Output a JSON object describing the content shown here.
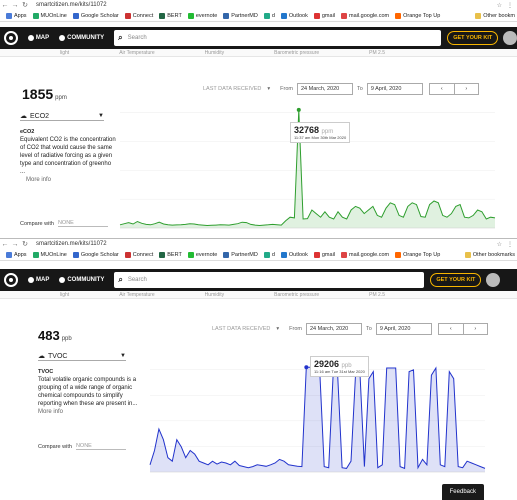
{
  "browser": {
    "url": "smartcitizen.me/kits/11072",
    "bookmarks": [
      "Apps",
      "MUOnLine",
      "Google Scholar",
      "Connect",
      "BERT",
      "evernote",
      "PartnerMD",
      "d",
      "Outlook",
      "gmail",
      "mail.google.com",
      "Orange Top Up"
    ],
    "other_bookmarks_a": "Other bookm",
    "other_bookmarks_b": "Other bookmarks"
  },
  "site": {
    "map_label": "MAP",
    "community_label": "COMMUNITY",
    "search_placeholder": "Search",
    "get_kit_label": "GET YOUR KIT",
    "table_headers": [
      "light",
      "Air Temperature",
      "Humidity",
      "Barometric pressure",
      "PM 2.5"
    ]
  },
  "panels": [
    {
      "value": "1855",
      "unit": "ppm",
      "sensor": "ECO2",
      "desc_title": "eCO2",
      "desc_text": "Equivalent CO2 is the concentration of CO2 that would cause the same level of radiative forcing as a given type and concentration of greenho ...",
      "more": "More info",
      "compare_label": "Compare with",
      "compare_value": "NONE",
      "last_data": "LAST DATA RECEIVED",
      "from_label": "From",
      "from_date": "24 March, 2020",
      "to_label": "To",
      "to_date": "9 April, 2020",
      "prev": "‹",
      "next": "›",
      "tooltip_value": "32768",
      "tooltip_unit": "ppm",
      "tooltip_date": "11:37 am Mon 30th Mar 2020"
    },
    {
      "value": "483",
      "unit": "ppb",
      "sensor": "TVOC",
      "desc_title": "TVOC",
      "desc_text": "Total volatile organic compounds is a grouping of a wide range of organic chemical compounds to simplify reporting when these are present in...",
      "more": "More info",
      "compare_label": "Compare with",
      "compare_value": "NONE",
      "last_data": "LAST DATA RECEIVED",
      "from_label": "From",
      "from_date": "24 March, 2020",
      "to_label": "To",
      "to_date": "9 April, 2020",
      "prev": "‹",
      "next": "›",
      "tooltip_value": "29206",
      "tooltip_unit": "ppb",
      "tooltip_date": "11:16 am Tue 31st Mar 2020"
    }
  ],
  "feedback_label": "Feedback",
  "chart_data": [
    {
      "type": "area",
      "series": [
        {
          "values": [
            900,
            1200,
            1500,
            1100,
            1800,
            1300,
            1000,
            900,
            1200,
            1600,
            1100,
            900,
            800,
            850,
            900,
            1000,
            1200,
            1100,
            900,
            800,
            700,
            750,
            800,
            900,
            850,
            800,
            1000,
            1200,
            1600,
            1500,
            1000,
            800,
            700,
            800,
            900,
            1000,
            900,
            800,
            2000,
            3000,
            2800,
            32768,
            2500,
            2600,
            5000,
            4000,
            3000,
            4500,
            3000,
            2500,
            4500,
            3000,
            2500,
            5000,
            6000,
            5500,
            4000,
            5000,
            6000,
            3500,
            3000,
            5500,
            7000,
            6500,
            3500,
            3000,
            6000,
            7000,
            6500,
            3200,
            3000,
            6500,
            7500,
            7000,
            3500,
            3000,
            4000,
            6000,
            6500,
            3000,
            2800,
            3500,
            5000,
            4500,
            2500,
            3000,
            2800
          ]
        }
      ],
      "color": "#2e9e2e"
    },
    {
      "type": "area",
      "series": [
        {
          "values": [
            2000,
            6000,
            12000,
            9000,
            4000,
            3000,
            9000,
            7000,
            4000,
            6000,
            5000,
            3000,
            2500,
            2000,
            3000,
            2200,
            2800,
            2500,
            2000,
            3000,
            1800,
            1500,
            1200,
            1500,
            2000,
            1800,
            1600,
            2000,
            2500,
            3500,
            3000,
            2000,
            1800,
            1600,
            1500,
            29206,
            29206,
            29206,
            28500,
            1500,
            1200,
            27000,
            27500,
            1200,
            1000,
            3000,
            27000,
            28000,
            1500,
            26000,
            28000,
            1200,
            2000,
            29000,
            29000,
            29000,
            1500,
            1000,
            28000,
            28500,
            1200,
            3500,
            2000,
            27000,
            29000,
            2000,
            1500,
            28000,
            26000,
            1500,
            1200,
            3000,
            2500,
            2000,
            1500,
            1000
          ]
        }
      ],
      "color": "#2233cc"
    }
  ]
}
